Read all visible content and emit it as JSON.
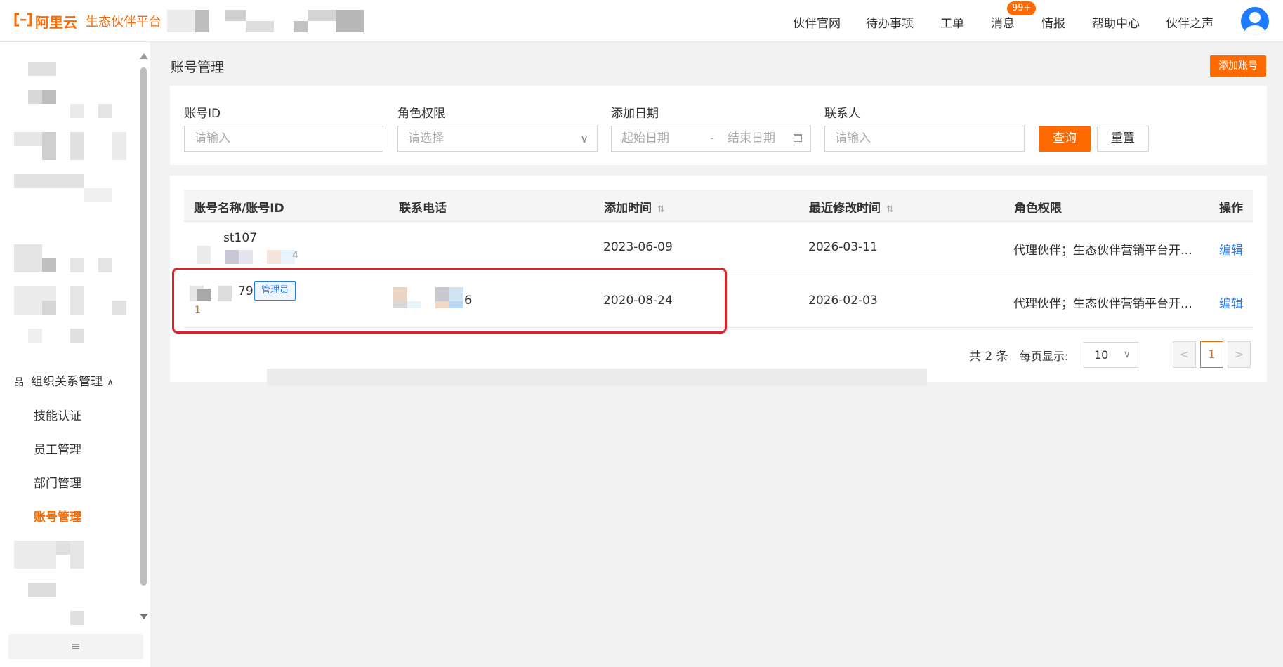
{
  "header": {
    "logo_text": "阿里云",
    "platform_name": "生态伙伴平台",
    "nav": [
      {
        "label": "伙伴官网"
      },
      {
        "label": "待办事项"
      },
      {
        "label": "工单"
      },
      {
        "label": "消息",
        "badge": "99+"
      },
      {
        "label": "情报"
      },
      {
        "label": "帮助中心"
      },
      {
        "label": "伙伴之声"
      }
    ]
  },
  "sidebar": {
    "group": {
      "label": "组织关系管理",
      "icon": "org-icon",
      "expanded": true
    },
    "items": [
      {
        "label": "技能认证"
      },
      {
        "label": "员工管理"
      },
      {
        "label": "部门管理"
      },
      {
        "label": "账号管理",
        "active": true
      }
    ],
    "collapse_icon": "≡"
  },
  "page": {
    "title": "账号管理",
    "add_button": "添加账号"
  },
  "filters": {
    "account_id": {
      "label": "账号ID",
      "placeholder": "请输入"
    },
    "role": {
      "label": "角色权限",
      "placeholder": "请选择"
    },
    "date": {
      "label": "添加日期",
      "start_placeholder": "起始日期",
      "separator": "-",
      "end_placeholder": "结束日期"
    },
    "contact": {
      "label": "联系人",
      "placeholder": "请输入"
    },
    "query_button": "查询",
    "reset_button": "重置"
  },
  "table": {
    "columns": [
      "账号名称/账号ID",
      "联系电话",
      "添加时间",
      "最近修改时间",
      "角色权限",
      "操作"
    ],
    "rows": [
      {
        "name": "st107",
        "id_suffix": "4",
        "phone": "",
        "added": "2023-06-09",
        "modified": "2026-03-11",
        "role": "代理伙伴；生态伙伴营销平台开…",
        "action": "编辑"
      },
      {
        "name": "79",
        "id_suffix": "1",
        "tag": "管理员",
        "phone": "6",
        "added": "2020-08-24",
        "modified": "2026-02-03",
        "role": "代理伙伴；生态伙伴营销平台开…",
        "action": "编辑"
      }
    ]
  },
  "pagination": {
    "total_text": "共 2 条",
    "page_size_label": "每页显示:",
    "page_size": "10",
    "current_page": "1"
  },
  "colors": {
    "brand": "#ff6a00",
    "link": "#1f7bff",
    "highlight": "#e0202a"
  }
}
